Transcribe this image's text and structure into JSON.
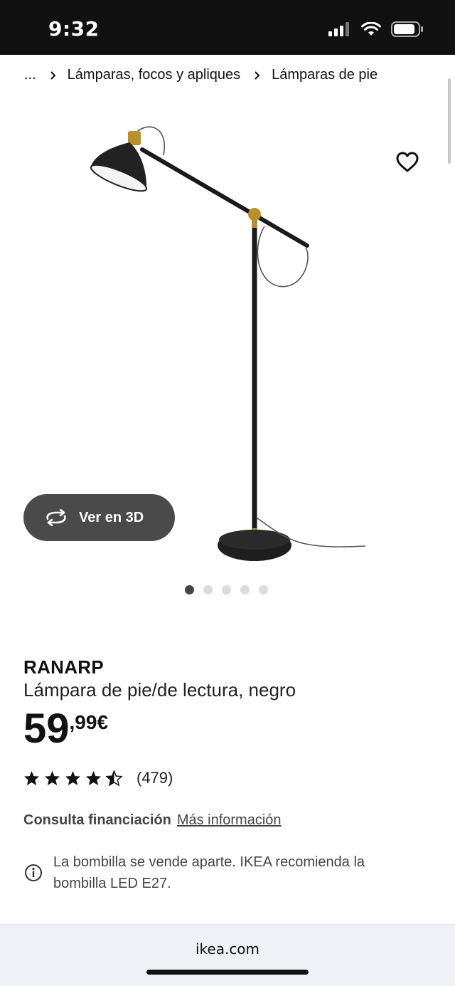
{
  "status_bar": {
    "time": "9:32"
  },
  "breadcrumb": {
    "ellipsis": "...",
    "items": [
      "Lámparas, focos y apliques",
      "Lámparas de pie"
    ]
  },
  "product": {
    "view_3d_label": "Ver en 3D",
    "gallery": {
      "total_images": 5,
      "active_index": 0
    },
    "brand": "RANARP",
    "description": "Lámpara de pie/de lectura, negro",
    "price": {
      "integer": "59",
      "decimal": ",99€"
    },
    "rating": {
      "stars": 4.5,
      "count": "(479)"
    },
    "financing": {
      "label": "Consulta financiación",
      "link": "Más información"
    },
    "notice": "La bombilla se vende aparte. IKEA recomienda la bombilla LED E27."
  },
  "browser": {
    "url": "ikea.com"
  },
  "colors": {
    "status_bar": "#111111",
    "button_3d": "#4a4a4a",
    "text": "#111111",
    "bottom_bar": "#eef2f6"
  },
  "icons": [
    "signal-icon",
    "wifi-icon",
    "battery-icon",
    "chevron-right-icon",
    "heart-icon",
    "rotate-3d-icon",
    "star-icon",
    "info-icon"
  ]
}
